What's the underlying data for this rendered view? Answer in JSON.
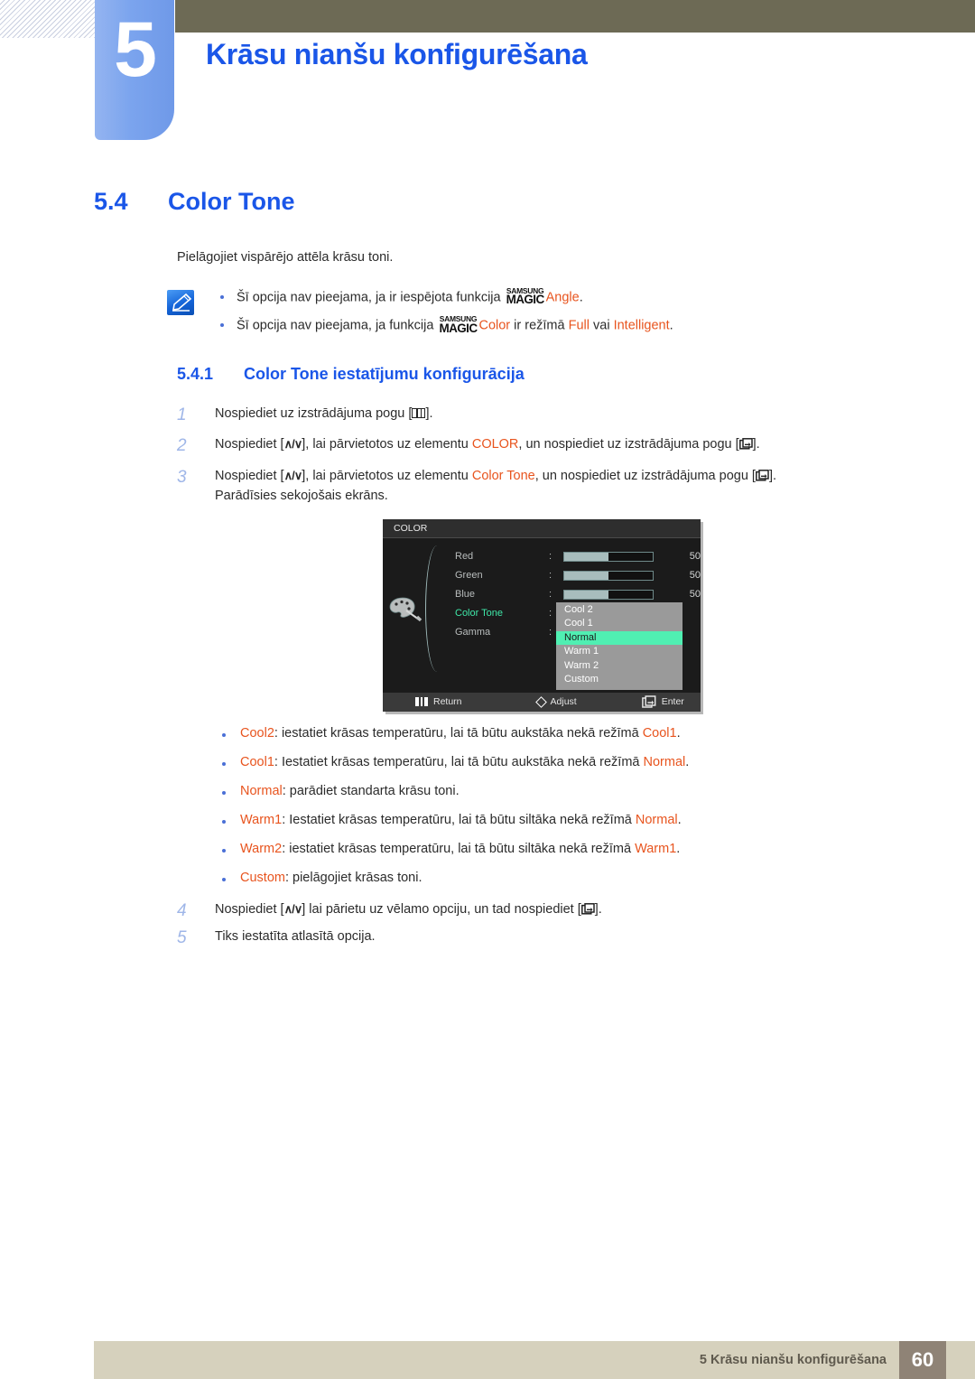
{
  "header": {
    "chapter_number": "5",
    "chapter_title": "Krāsu nianšu konfigurēšana",
    "accent_blue": "#1a56e8",
    "tab_blue": "#7ba4ee",
    "bar_olive": "#6d6a55"
  },
  "section": {
    "number": "5.4",
    "title": "Color Tone",
    "intro": "Pielāgojiet vispārējo attēla krāsu toni."
  },
  "note": {
    "icon": "note-pencil-icon",
    "items": [
      {
        "pre": "Šī opcija nav pieejama, ja ir iespējota funkcija",
        "magic_top": "SAMSUNG",
        "magic_bottom": "MAGIC",
        "highlight": "Angle",
        "post": "."
      },
      {
        "pre": "Šī opcija nav pieejama, ja funkcija",
        "magic_top": "SAMSUNG",
        "magic_bottom": "MAGIC",
        "highlight": "Color",
        "mid": "ir režīmā",
        "highlight2": "Full",
        "mid2": "vai",
        "highlight3": "Intelligent",
        "post": "."
      }
    ]
  },
  "subsection": {
    "number": "5.4.1",
    "title": "Color Tone iestatījumu konfigurācija"
  },
  "steps": [
    {
      "n": "1",
      "parts": [
        {
          "t": "Nospiediet uz izstrādājuma pogu [",
          "c": "plain"
        },
        {
          "t": "menu-key-icon",
          "c": "key-menu"
        },
        {
          "t": "].",
          "c": "plain"
        }
      ]
    },
    {
      "n": "2",
      "parts": [
        {
          "t": "Nospiediet [",
          "c": "plain"
        },
        {
          "t": "∧/∨",
          "c": "key-arrows"
        },
        {
          "t": "], lai pārvietotos uz elementu ",
          "c": "plain"
        },
        {
          "t": "COLOR",
          "c": "orange"
        },
        {
          "t": ", un nospiediet uz izstrādājuma pogu [",
          "c": "plain"
        },
        {
          "t": "enter-key-icon",
          "c": "key-enter"
        },
        {
          "t": "].",
          "c": "plain"
        }
      ]
    },
    {
      "n": "3",
      "parts": [
        {
          "t": "Nospiediet [",
          "c": "plain"
        },
        {
          "t": "∧/∨",
          "c": "key-arrows"
        },
        {
          "t": "], lai pārvietotos uz elementu ",
          "c": "plain"
        },
        {
          "t": "Color Tone",
          "c": "orange"
        },
        {
          "t": ", un nospiediet uz izstrādājuma pogu [",
          "c": "plain"
        },
        {
          "t": "enter-key-icon",
          "c": "key-enter"
        },
        {
          "t": "].",
          "c": "plain"
        }
      ],
      "line2": "Parādīsies sekojošais ekrāns."
    },
    {
      "n": "4",
      "parts": [
        {
          "t": "Nospiediet [",
          "c": "plain"
        },
        {
          "t": "∧/∨",
          "c": "key-arrows"
        },
        {
          "t": "] lai pārietu uz vēlamo opciju, un tad nospiediet [",
          "c": "plain"
        },
        {
          "t": "enter-key-icon",
          "c": "key-enter"
        },
        {
          "t": "].",
          "c": "plain"
        }
      ]
    },
    {
      "n": "5",
      "parts": [
        {
          "t": "Tiks iestatīta atlasītā opcija.",
          "c": "plain"
        }
      ]
    }
  ],
  "osd": {
    "title": "COLOR",
    "icon": "palette-icon",
    "rows": [
      {
        "label": "Red",
        "value": "50",
        "fill_pct": 50,
        "type": "slider",
        "active": false
      },
      {
        "label": "Green",
        "value": "50",
        "fill_pct": 50,
        "type": "slider",
        "active": false
      },
      {
        "label": "Blue",
        "value": "50",
        "fill_pct": 50,
        "type": "slider",
        "active": false
      },
      {
        "label": "Color Tone",
        "value": "",
        "fill_pct": 0,
        "type": "menu",
        "active": true
      },
      {
        "label": "Gamma",
        "value": "",
        "fill_pct": 0,
        "type": "menu",
        "active": false
      }
    ],
    "dropdown": {
      "options": [
        "Cool 2",
        "Cool 1",
        "Normal",
        "Warm 1",
        "Warm 2",
        "Custom"
      ],
      "selected": "Normal",
      "selected_index": 2,
      "bg_color": "#9a9a9a",
      "highlight_color": "#50efb2"
    },
    "footer": [
      {
        "icon": "return-icon",
        "label": "Return"
      },
      {
        "icon": "diamond-icon",
        "label": "Adjust"
      },
      {
        "icon": "enter-icon",
        "label": "Enter"
      }
    ]
  },
  "options": [
    {
      "name": "Cool2",
      "rest": ": iestatiet krāsas temperatūru, lai tā būtu aukstāka nekā režīmā ",
      "ref": "Cool1",
      "end": "."
    },
    {
      "name": "Cool1",
      "rest": ": Iestatiet krāsas temperatūru, lai tā būtu aukstāka nekā režīmā ",
      "ref": "Normal",
      "end": "."
    },
    {
      "name": "Normal",
      "rest": ": parādiet standarta krāsu toni.",
      "ref": "",
      "end": ""
    },
    {
      "name": "Warm1",
      "rest": ": Iestatiet krāsas temperatūru, lai tā būtu siltāka nekā režīmā ",
      "ref": "Normal",
      "end": "."
    },
    {
      "name": "Warm2",
      "rest": ": iestatiet krāsas temperatūru, lai tā būtu siltāka nekā režīmā ",
      "ref": "Warm1",
      "end": "."
    },
    {
      "name": "Custom",
      "rest": ": pielāgojiet krāsas toni.",
      "ref": "",
      "end": ""
    }
  ],
  "footer": {
    "text": "5 Krāsu nianšu konfigurēšana",
    "page": "60",
    "bar_color": "#d6d1bd",
    "page_color": "#8f8376"
  }
}
